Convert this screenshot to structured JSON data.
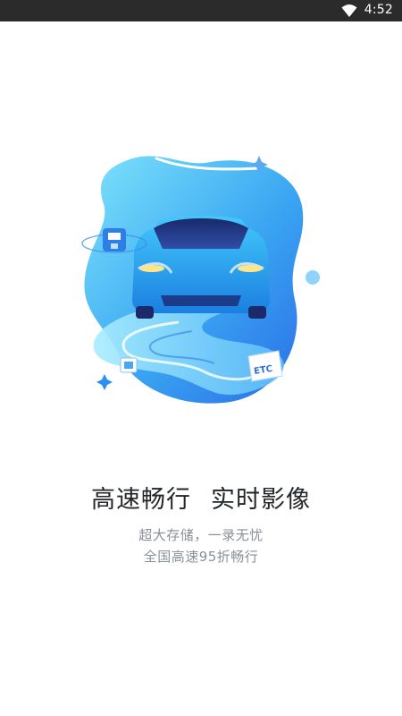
{
  "status_bar": {
    "time": "4:52",
    "wifi_icon": "wifi-icon"
  },
  "onboarding": {
    "title_part1": "高速畅行",
    "title_part2": "实时影像",
    "subtitle_line1": "超大存储，一录无忧",
    "subtitle_line2": "全国高速95折畅行",
    "etc_badge": "ETC"
  },
  "colors": {
    "accent_blue": "#2b8ff0",
    "status_bar_bg": "#2b2b2b"
  }
}
